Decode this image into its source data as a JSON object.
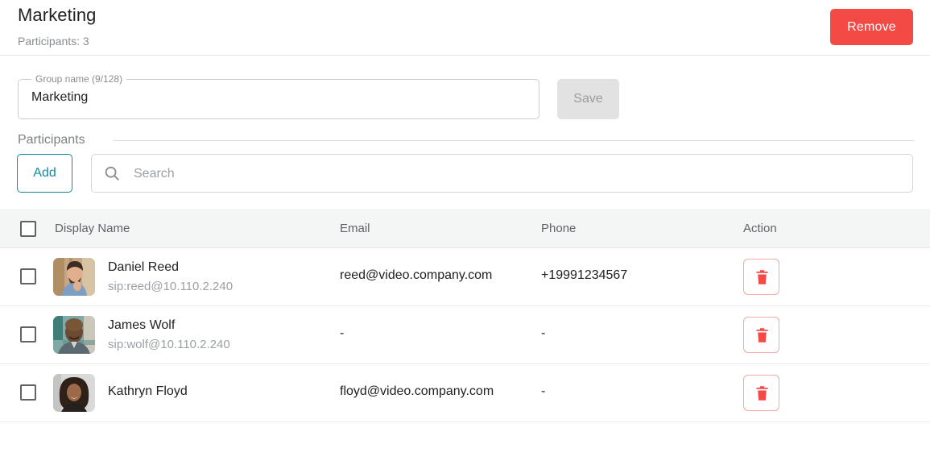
{
  "header": {
    "title": "Marketing",
    "participants_count": "Participants: 3",
    "remove_label": "Remove"
  },
  "group_form": {
    "field_label": "Group name (9/128)",
    "field_value": "Marketing",
    "save_label": "Save"
  },
  "participants_section": {
    "section_label": "Participants",
    "add_label": "Add",
    "search_placeholder": "Search",
    "search_value": ""
  },
  "table": {
    "columns": {
      "name": "Display Name",
      "email": "Email",
      "phone": "Phone",
      "action": "Action"
    },
    "rows": [
      {
        "name": "Daniel Reed",
        "sip": "sip:reed@10.110.2.240",
        "email": "reed@video.company.com",
        "phone": "+19991234567"
      },
      {
        "name": "James Wolf",
        "sip": "sip:wolf@10.110.2.240",
        "email": "-",
        "phone": "-"
      },
      {
        "name": "Kathryn Floyd",
        "sip": "",
        "email": "floyd@video.company.com",
        "phone": "-"
      }
    ]
  },
  "colors": {
    "danger": "#f44a46",
    "accent_teal": "#0e8c9e",
    "disabled_bg": "#e2e2e2",
    "header_bg": "#f4f5f5"
  }
}
